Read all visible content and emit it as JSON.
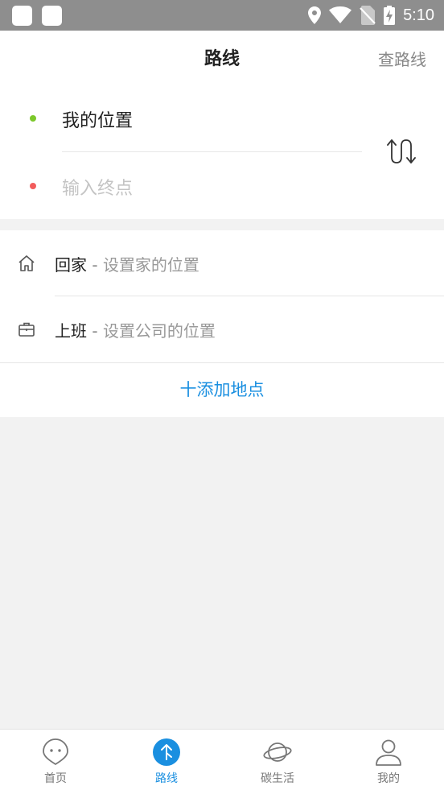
{
  "status_bar": {
    "time": "5:10"
  },
  "header": {
    "title": "路线",
    "query_link": "查路线"
  },
  "route": {
    "start": "我的位置",
    "end_placeholder": "输入终点"
  },
  "shortcuts": {
    "home": {
      "label": "回家",
      "separator": " - ",
      "hint": "设置家的位置"
    },
    "work": {
      "label": "上班",
      "separator": " - ",
      "hint": "设置公司的位置"
    },
    "add_place": "十添加地点"
  },
  "tabs": [
    {
      "label": "首页",
      "icon": "home-face-icon",
      "active": false
    },
    {
      "label": "路线",
      "icon": "route-arrow-icon",
      "active": true
    },
    {
      "label": "碳生活",
      "icon": "planet-icon",
      "active": false
    },
    {
      "label": "我的",
      "icon": "user-icon",
      "active": false
    }
  ],
  "colors": {
    "accent": "#1a8fe0",
    "start_dot": "#7cc82b",
    "end_dot": "#f25c5c"
  }
}
